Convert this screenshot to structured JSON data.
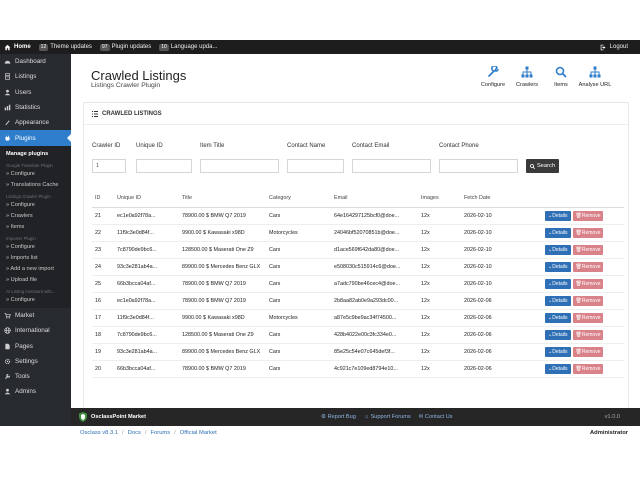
{
  "topbar": {
    "home": "Home",
    "theme_badge": "12",
    "theme_label": "Theme updates",
    "plugin_badge": "97",
    "plugin_label": "Plugin updates",
    "language_badge": "10",
    "language_label": "Language upda...",
    "logout": "Logout"
  },
  "sidebar": {
    "items": [
      {
        "label": "Dashboard",
        "icon": "dashboard-icon"
      },
      {
        "label": "Listings",
        "icon": "listings-icon"
      },
      {
        "label": "Users",
        "icon": "users-icon"
      },
      {
        "label": "Statistics",
        "icon": "statistics-icon"
      },
      {
        "label": "Appearance",
        "icon": "appearance-icon"
      },
      {
        "label": "Plugins",
        "icon": "plugins-icon"
      }
    ],
    "submenu": {
      "head": "Manage plugins",
      "g1": "Google Translate Plugin",
      "g1_configure": "» Configure",
      "g1_translations": "» Translations Cache",
      "g2": "Listings Crawler Plugin",
      "g2_configure": "» Configure",
      "g2_crawlers": "» Crawlers",
      "g2_items": "» Items",
      "g3": "Importer Plugin",
      "g3_configure": "» Configure",
      "g3_imports": "» Imports list",
      "g3_add": "» Add a new import",
      "g3_upload": "» Upload file",
      "g4": "AI Listing Assistant with...",
      "g4_configure": "» Configure"
    },
    "bottom_items": [
      {
        "label": "Market",
        "icon": "market-icon"
      },
      {
        "label": "International",
        "icon": "globe-icon"
      },
      {
        "label": "Pages",
        "icon": "pages-icon"
      },
      {
        "label": "Settings",
        "icon": "gear-icon"
      },
      {
        "label": "Tools",
        "icon": "tools-icon"
      },
      {
        "label": "Admins",
        "icon": "admins-icon"
      }
    ]
  },
  "header": {
    "title": "Crawled Listings",
    "subtitle": "Listings Crawler Plugin",
    "actions": [
      {
        "label": "Configure",
        "icon": "wrench-icon"
      },
      {
        "label": "Crawlers",
        "icon": "sitemap-icon"
      },
      {
        "label": "Items",
        "icon": "search-icon"
      },
      {
        "label": "Analyse URL",
        "icon": "sitemap-icon"
      }
    ]
  },
  "card": {
    "title": "CRAWLED LISTINGS",
    "filters": {
      "crawler_id_label": "Crawler ID",
      "crawler_id_value": "1",
      "unique_id_label": "Unique ID",
      "item_title_label": "Item Title",
      "contact_name_label": "Contact Name",
      "contact_email_label": "Contact Email",
      "contact_phone_label": "Contact Phone",
      "search_label": "Search"
    },
    "columns": [
      "ID",
      "Unique ID",
      "Title",
      "Category",
      "Email",
      "Images",
      "Fetch Date"
    ],
    "details_label": "Details",
    "remove_label": "Remove",
    "rows": [
      [
        "21",
        "ec1e0a92f78a...",
        "78900.00 $ BMW Q7 2019",
        "Cars",
        "64e164297125bcf0@doe...",
        "12x",
        "2026-02-10"
      ],
      [
        "22",
        "11f9c3e0d84f...",
        "9900.00 $ Kawasaki x98D",
        "Motorcycles",
        "24046bf52070851b@doe...",
        "12x",
        "2026-02-10"
      ],
      [
        "23",
        "7c8790de9bc6...",
        "128500.00 $ Maserati One Z9",
        "Cars",
        "d1ace569f642da80@doe...",
        "12x",
        "2026-02-10"
      ],
      [
        "24",
        "93c3e281ab4a...",
        "89900.00 $ Mercedes Benz GLX",
        "Cars",
        "e508030c515914c6@doe...",
        "12x",
        "2026-02-10"
      ],
      [
        "25",
        "66b3bcca04af...",
        "78900.00 $ BMW Q7 2019",
        "Cars",
        "a7adc790be46cec4@doe...",
        "12x",
        "2026-02-10"
      ],
      [
        "16",
        "ec1e0a92f78a...",
        "78900.00 $ BMW Q7 2019",
        "Cars",
        "2b8aa82ab0e9a293dc00...",
        "12x",
        "2026-02-06"
      ],
      [
        "17",
        "11f9c3e0d84f...",
        "9900.00 $ Kawasaki x98D",
        "Motorcycles",
        "a87e5c9be9ac34f74500...",
        "12x",
        "2026-02-06"
      ],
      [
        "18",
        "7c8790de9bc6...",
        "128500.00 $ Maserati One Z9",
        "Cars",
        "428b4022e00c3fc334e0...",
        "12x",
        "2026-02-06"
      ],
      [
        "19",
        "93c3e281ab4a...",
        "89900.00 $ Mercedes Benz GLX",
        "Cars",
        "85e25c54e07c645def3f...",
        "12x",
        "2026-02-06"
      ],
      [
        "20",
        "66b3bcca04af...",
        "78900.00 $ BMW Q7 2019",
        "Cars",
        "4c921c7e109ed8794e10...",
        "12x",
        "2026-02-06"
      ]
    ]
  },
  "footer": {
    "brand": "OsclassPoint Market",
    "report": "Report Bug",
    "support": "Support Forums",
    "contact": "Contact Us",
    "version": "v1.0.0"
  },
  "bottom": {
    "crumbs": [
      "Osclass v8.3.1",
      "Docs",
      "Forums",
      "Official Market"
    ],
    "admin": "Administrator"
  },
  "colors": {
    "accent": "#2f7ecb",
    "sidebar": "#272a2f",
    "topbar": "#1d1d1d",
    "details": "#2f6fb5",
    "remove": "#d9828a"
  }
}
